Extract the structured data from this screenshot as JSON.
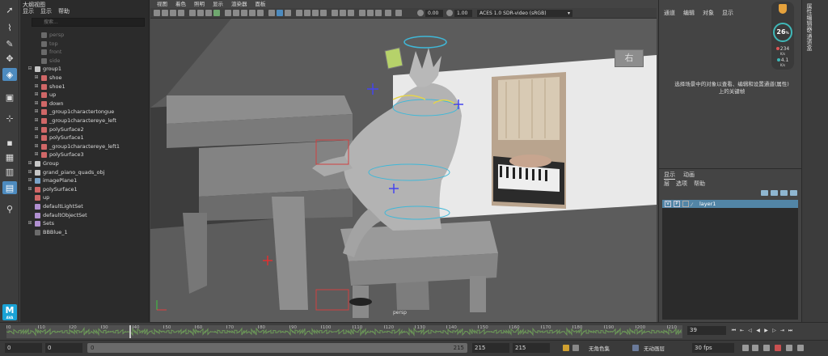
{
  "outliner": {
    "title": "大纲视图",
    "menus": [
      "显示",
      "显示",
      "帮助"
    ],
    "search_placeholder": "搜索...",
    "items": [
      {
        "label": "persp",
        "dim": true,
        "indent": 1,
        "type": "camera"
      },
      {
        "label": "top",
        "dim": true,
        "indent": 1,
        "type": "camera"
      },
      {
        "label": "front",
        "dim": true,
        "indent": 1,
        "type": "camera"
      },
      {
        "label": "side",
        "dim": true,
        "indent": 1,
        "type": "camera"
      },
      {
        "label": "group1",
        "dim": false,
        "indent": 0,
        "type": "group",
        "expander": "minus"
      },
      {
        "label": "shoe",
        "dim": false,
        "indent": 1,
        "type": "mesh",
        "expander": "plus"
      },
      {
        "label": "shoe1",
        "dim": false,
        "indent": 1,
        "type": "mesh",
        "expander": "plus"
      },
      {
        "label": "up",
        "dim": false,
        "indent": 1,
        "type": "mesh",
        "expander": "plus"
      },
      {
        "label": "down",
        "dim": false,
        "indent": 1,
        "type": "mesh",
        "expander": "plus"
      },
      {
        "label": "_group1charactertongue",
        "dim": false,
        "indent": 1,
        "type": "mesh",
        "expander": "plus"
      },
      {
        "label": "_group1charactereye_left",
        "dim": false,
        "indent": 1,
        "type": "mesh",
        "expander": "plus"
      },
      {
        "label": "polySurface2",
        "dim": false,
        "indent": 1,
        "type": "mesh",
        "expander": "plus"
      },
      {
        "label": "polySurface1",
        "dim": false,
        "indent": 1,
        "type": "mesh",
        "expander": "plus"
      },
      {
        "label": "_group1charactereye_left1",
        "dim": false,
        "indent": 1,
        "type": "mesh",
        "expander": "plus"
      },
      {
        "label": "polySurface3",
        "dim": false,
        "indent": 1,
        "type": "mesh",
        "expander": "plus"
      },
      {
        "label": "Group",
        "dim": false,
        "indent": 0,
        "type": "group",
        "expander": "plus"
      },
      {
        "label": "grand_piano_quads_obj",
        "dim": false,
        "indent": 0,
        "type": "group",
        "expander": "plus"
      },
      {
        "label": "imagePlane1",
        "dim": false,
        "indent": 0,
        "type": "image",
        "expander": "plus"
      },
      {
        "label": "polySurface1",
        "dim": false,
        "indent": 0,
        "type": "mesh",
        "expander": "plus"
      },
      {
        "label": "up",
        "dim": false,
        "indent": 0,
        "type": "mesh",
        "expander": ""
      },
      {
        "label": "defaultLightSet",
        "dim": false,
        "indent": 0,
        "type": "set",
        "expander": ""
      },
      {
        "label": "defaultObjectSet",
        "dim": false,
        "indent": 0,
        "type": "set",
        "expander": ""
      },
      {
        "label": "Sets",
        "dim": false,
        "indent": 0,
        "type": "set",
        "expander": "plus"
      },
      {
        "label": "BBBlue_1",
        "dim": false,
        "indent": 0,
        "type": "material",
        "expander": ""
      }
    ]
  },
  "viewport": {
    "menus": [
      "视图",
      "着色",
      "照明",
      "显示",
      "渲染器",
      "面板"
    ],
    "toolbar": {
      "exposure": "0.00",
      "gamma": "1.00",
      "colorspace": "ACES 1.0 SDR-video (sRGB)"
    },
    "camera_label": "persp",
    "viewcube_label": "右"
  },
  "channelbox": {
    "menus": [
      "通道",
      "编辑",
      "对象",
      "显示"
    ],
    "message_line1": "选择场景中的对象以查看、编辑和设置通道(属性)",
    "message_line2": "上的关键帧"
  },
  "layers": {
    "tabs": [
      "显示",
      "动画"
    ],
    "menus": [
      "层",
      "选项",
      "帮助"
    ],
    "rows": [
      {
        "v": "V",
        "p": "P",
        "name": "layer1"
      }
    ]
  },
  "hud": {
    "value": "26",
    "unit": "%",
    "stat1": "234",
    "stat1_unit": "K/s",
    "stat2": "4.1",
    "stat2_unit": "K/s"
  },
  "attribute_strip": {
    "label": "属性编辑器/通道盒"
  },
  "timeslider": {
    "ticks": [
      0,
      10,
      20,
      30,
      40,
      50,
      60,
      70,
      80,
      90,
      100,
      110,
      120,
      130,
      140,
      150,
      160,
      170,
      180,
      190,
      200,
      210
    ],
    "range_min": 0,
    "range_max": 215,
    "current_frame": 39,
    "current_frame_display": "39"
  },
  "rangeslider": {
    "start": "0",
    "inner_start": "0",
    "bar_start": "0",
    "bar_end": "215",
    "inner_end": "215",
    "end": "215",
    "character_set": "无角色集",
    "anim_layer": "无动画层",
    "fps": "30 fps"
  },
  "colors": {
    "accent": "#4d8bbf",
    "layer_row": "#5285a6",
    "maya_logo": "#1aa3d6"
  }
}
